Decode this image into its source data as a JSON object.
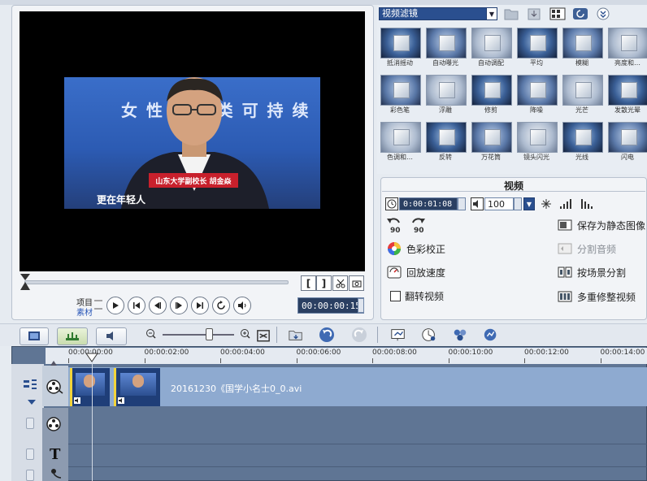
{
  "player": {
    "banner_title": "女 性 . . . 类 可 持 续",
    "caption_name": "山东大学副校长 胡金焱",
    "caption_sub": "更在年轻人",
    "label_project": "项目",
    "label_clip": "素材",
    "timecode": "00:00:00:15",
    "mark_in": "[",
    "mark_out": "]"
  },
  "filter_panel": {
    "category": "视频滤镜",
    "filters": [
      "抵消摇动",
      "自动曝光",
      "自动调配",
      "平均",
      "模糊",
      "亮度和…",
      "彩色笔",
      "浮雕",
      "修剪",
      "降噪",
      "光芒",
      "发散光晕",
      "色调和…",
      "反转",
      "万花筒",
      "镜头闪光",
      "光线",
      "闪电"
    ]
  },
  "options": {
    "tab_title": "视频",
    "duration": "0:00:01:08",
    "volume": "100",
    "actions": {
      "save_still": "保存为静态图像",
      "color_correct": "色彩校正",
      "split_audio": "分割音频",
      "playback_speed": "回放速度",
      "scene_split": "按场景分割",
      "reverse": "翻转视频",
      "multi_trim": "多重修整视频"
    }
  },
  "timeline": {
    "ruler_labels": [
      "00:00:00:00",
      "00:00:02:00",
      "00:00:04:00",
      "00:00:06:00",
      "00:00:08:00",
      "00:00:10:00",
      "00:00:12:00",
      "00:00:14:00"
    ],
    "clip_name": "20161230《国学小名士0_0.avi",
    "title_track": "T"
  },
  "colors": {
    "timeline_bg": "#5f7594",
    "clip_track": "#8eaad0",
    "clip_border": "#f2d43a"
  }
}
